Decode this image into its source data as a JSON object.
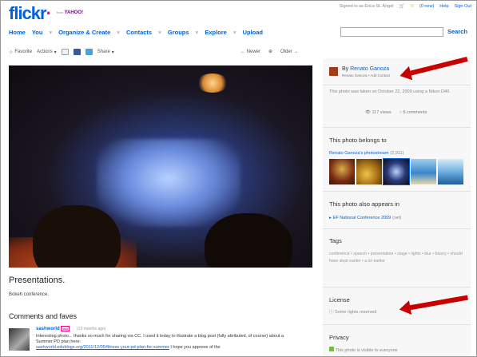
{
  "header": {
    "logo_part1": "flickr",
    "logo_part2": "",
    "logo_suffix": "from",
    "yahoo": "YAHOO!",
    "signed_in": "Signed in as Erica St. Angel",
    "inbox": "(0 new)",
    "help": "Help",
    "sign_out": "Sign Out",
    "nav": [
      "Home",
      "You",
      "Organize & Create",
      "Contacts",
      "Groups",
      "Explore",
      "Upload"
    ],
    "search_label": "Search",
    "search_value": ""
  },
  "toolbar": {
    "favorite": "Favorite",
    "actions": "Actions",
    "share": "Share",
    "newer": "← Newer",
    "older": "Older →"
  },
  "photo": {
    "title": "Presentations.",
    "description": "Bokeh conference."
  },
  "comments": {
    "heading": "Comments and faves",
    "items": [
      {
        "user": "sashworld",
        "badge": "pro",
        "time": "(13 months ago)",
        "text": "Interesting photo... thanks so much for sharing via CC. I used it today to illustrate a blog post (fully attributed, of course) about a Summer PD plan here:",
        "link": "sashworld.edublogs.org/2011/12/05/fitness-your-pd-plan-for-summer",
        "trail": "I hope you approve of the"
      }
    ]
  },
  "sidebar": {
    "owner_by": "By",
    "owner_name": "Renato Ganoza",
    "owner_sub": "Renato Ganoza  •  Add Contact",
    "taken_text": "This photo was taken on October 22, 2009 using a Nikon D40.",
    "views": "117 views",
    "comments_count": "5 comments",
    "belongs_heading": "This photo belongs to",
    "photostream": "Renato Ganoza's photostream",
    "photostream_count": "(2,911)",
    "appears_heading": "This photo also appears in",
    "set_name": "EF National Conference 2009",
    "set_count": "(set)",
    "tags_heading": "Tags",
    "tags_text": "conference  •  speech  •  presentation  •  stage  •  lights  •  blur  •  bluury  •  should have slept earlier  •  a lot earlier",
    "license_heading": "License",
    "license_text": "Some rights reserved",
    "privacy_heading": "Privacy",
    "privacy_text": "This photo is visible to everyone"
  },
  "colors": {
    "flickr_blue": "#0063dc",
    "flickr_pink": "#ff0084",
    "arrow_red": "#c80000"
  }
}
